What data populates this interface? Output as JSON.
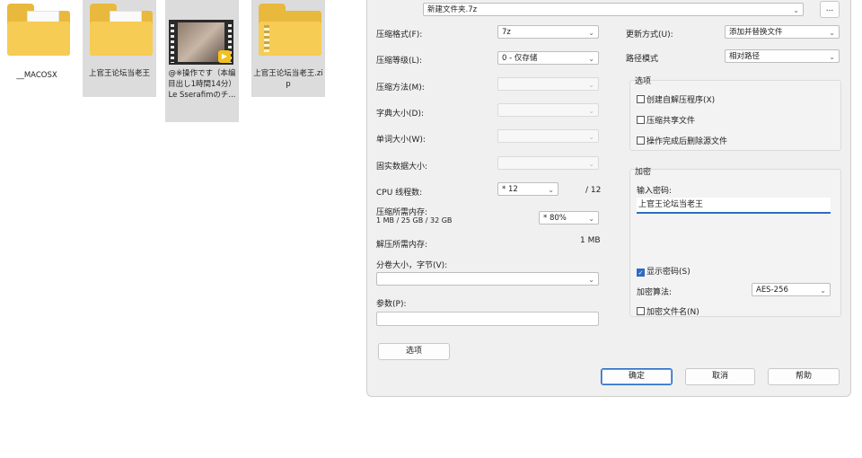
{
  "desktop": {
    "items": [
      {
        "label": "__MACOSX"
      },
      {
        "label": "上官王论坛当老王"
      },
      {
        "label": "@※操作です（本编目出し1時間14分）Le Sserafimのチ..."
      },
      {
        "label": "上官王论坛当老王.zip"
      }
    ]
  },
  "dialog": {
    "archive_name": "新建文件夹.7z",
    "browse_label": "...",
    "left": {
      "format_label": "压缩格式(F):",
      "format_value": "7z",
      "level_label": "压缩等级(L):",
      "level_value": "0 - 仅存储",
      "method_label": "压缩方法(M):",
      "dict_label": "字典大小(D):",
      "word_label": "单词大小(W):",
      "solid_label": "固实数据大小:",
      "cpu_label": "CPU 线程数:",
      "cpu_value": "* 12",
      "cpu_total": "/ 12",
      "mem_label": "压缩所需内存:",
      "mem_detail": "1 MB / 25 GB / 32 GB",
      "mem_value": "* 80%",
      "decomp_label": "解压所需内存:",
      "decomp_value": "1 MB",
      "split_label": "分卷大小，字节(V):",
      "params_label": "参数(P):",
      "options_button": "选项"
    },
    "right": {
      "update_label": "更新方式(U):",
      "update_value": "添加并替换文件",
      "path_label": "路径模式",
      "path_value": "相对路径",
      "options_group": "选项",
      "opt_sfx": "创建自解压程序(X)",
      "opt_shared": "压缩共享文件",
      "opt_delete": "操作完成后删除源文件",
      "encrypt_group": "加密",
      "password_label": "输入密码:",
      "password_value": "上官王论坛当老王",
      "show_password": "显示密码(S)",
      "enc_method_label": "加密算法:",
      "enc_method_value": "AES-256",
      "encrypt_names": "加密文件名(N)"
    },
    "buttons": {
      "ok": "确定",
      "cancel": "取消",
      "help": "帮助"
    }
  },
  "colors": {
    "accent": "#2b6cc4",
    "folder": "#f6cc55"
  }
}
